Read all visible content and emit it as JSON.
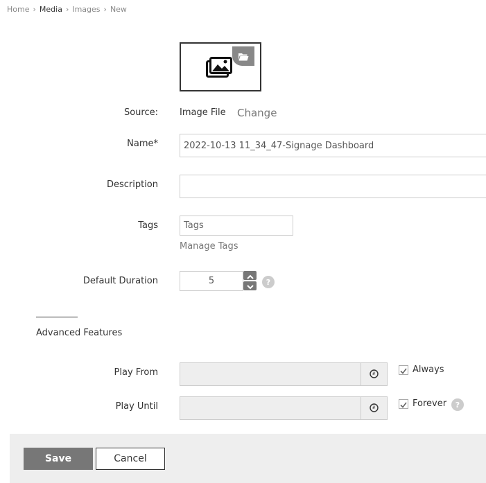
{
  "breadcrumb": [
    {
      "label": "Home",
      "current": false
    },
    {
      "label": "Media",
      "current": true
    },
    {
      "label": "Images",
      "current": false
    },
    {
      "label": "New",
      "current": false
    }
  ],
  "preview": {
    "icon": "image-gallery-icon",
    "badge_icon": "folder-open-icon"
  },
  "source": {
    "label": "Source:",
    "value": "Image File",
    "change_link": "Change"
  },
  "name": {
    "label": "Name*",
    "value": "2022-10-13 11_34_47-Signage Dashboard"
  },
  "description": {
    "label": "Description",
    "value": ""
  },
  "tags": {
    "label": "Tags",
    "placeholder": "Tags",
    "manage_link": "Manage Tags"
  },
  "duration": {
    "label": "Default Duration",
    "value": "5",
    "help": "?"
  },
  "advanced": {
    "heading": "Advanced Features"
  },
  "play_from": {
    "label": "Play From",
    "value": "",
    "checkbox_label": "Always",
    "checked": true
  },
  "play_until": {
    "label": "Play Until",
    "value": "",
    "checkbox_label": "Forever",
    "checked": true,
    "help": "?"
  },
  "buttons": {
    "save": "Save",
    "cancel": "Cancel"
  },
  "colors": {
    "save_bg": "#777777",
    "footer_bg": "#eeeeee",
    "disabled_field": "#eeeeee"
  }
}
